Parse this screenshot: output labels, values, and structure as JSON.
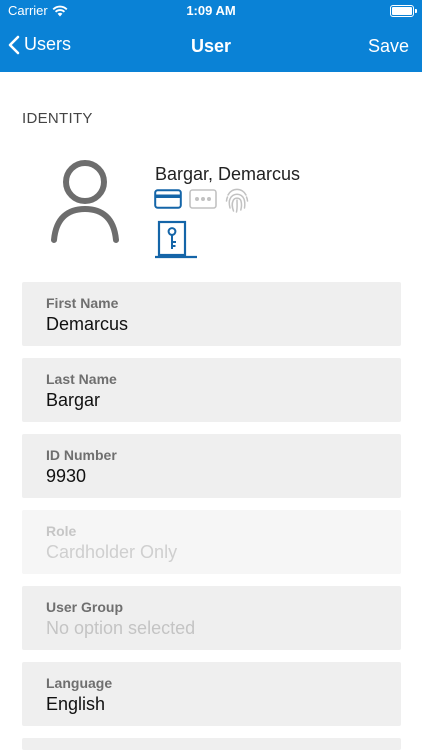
{
  "status_bar": {
    "carrier": "Carrier",
    "time": "1:09 AM"
  },
  "nav": {
    "back_label": "Users",
    "title": "User",
    "save_label": "Save"
  },
  "identity": {
    "section_header": "IDENTITY",
    "name": "Bargar, Demarcus",
    "credential_icons": [
      "card-icon",
      "pin-icon",
      "fingerprint-icon",
      "door-key-icon"
    ]
  },
  "fields": [
    {
      "label": "First Name",
      "value": "Demarcus"
    },
    {
      "label": "Last Name",
      "value": "Bargar"
    },
    {
      "label": "ID Number",
      "value": "9930"
    },
    {
      "label": "Role",
      "value": "Cardholder Only"
    },
    {
      "label": "User Group",
      "value": "No option selected"
    },
    {
      "label": "Language",
      "value": "English"
    }
  ],
  "colors": {
    "accent": "#0a82d6",
    "field_bg": "#efefef",
    "icon_blue": "#1465a8",
    "icon_gray": "#c2c2c2"
  }
}
